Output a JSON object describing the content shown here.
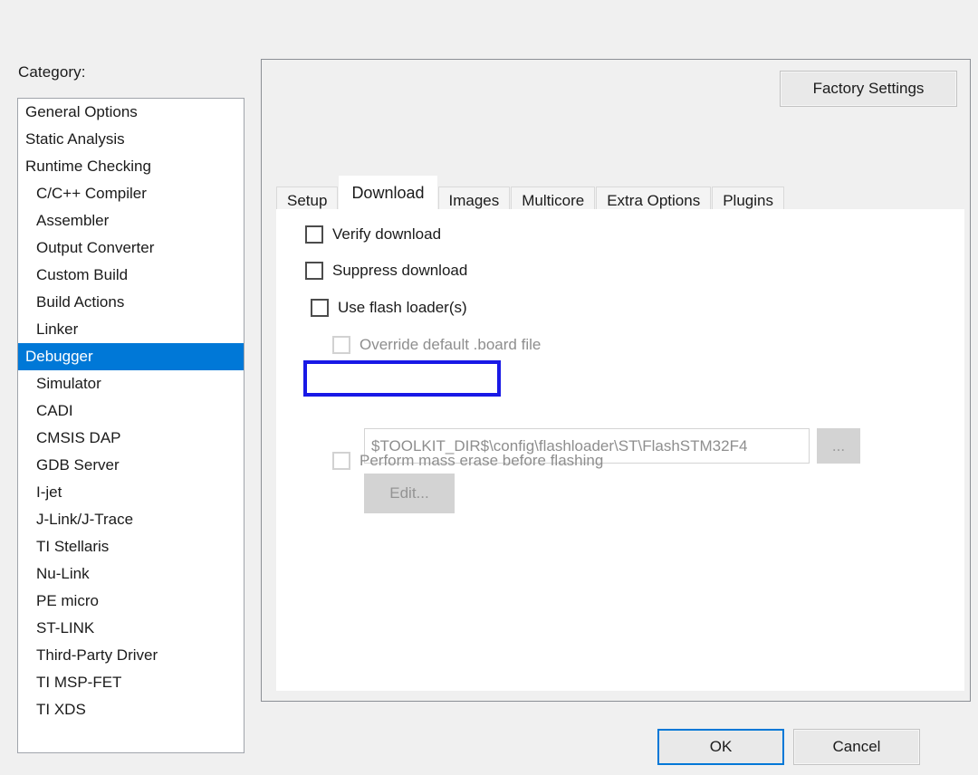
{
  "category": {
    "label": "Category:",
    "items": [
      {
        "label": "General Options",
        "indent": false,
        "selected": false
      },
      {
        "label": "Static Analysis",
        "indent": false,
        "selected": false
      },
      {
        "label": "Runtime Checking",
        "indent": false,
        "selected": false
      },
      {
        "label": "C/C++ Compiler",
        "indent": true,
        "selected": false
      },
      {
        "label": "Assembler",
        "indent": true,
        "selected": false
      },
      {
        "label": "Output Converter",
        "indent": true,
        "selected": false
      },
      {
        "label": "Custom Build",
        "indent": true,
        "selected": false
      },
      {
        "label": "Build Actions",
        "indent": true,
        "selected": false
      },
      {
        "label": "Linker",
        "indent": true,
        "selected": false
      },
      {
        "label": "Debugger",
        "indent": false,
        "selected": true
      },
      {
        "label": "Simulator",
        "indent": true,
        "selected": false
      },
      {
        "label": "CADI",
        "indent": true,
        "selected": false
      },
      {
        "label": "CMSIS DAP",
        "indent": true,
        "selected": false
      },
      {
        "label": "GDB Server",
        "indent": true,
        "selected": false
      },
      {
        "label": "I-jet",
        "indent": true,
        "selected": false
      },
      {
        "label": "J-Link/J-Trace",
        "indent": true,
        "selected": false
      },
      {
        "label": "TI Stellaris",
        "indent": true,
        "selected": false
      },
      {
        "label": "Nu-Link",
        "indent": true,
        "selected": false
      },
      {
        "label": "PE micro",
        "indent": true,
        "selected": false
      },
      {
        "label": "ST-LINK",
        "indent": true,
        "selected": false
      },
      {
        "label": "Third-Party Driver",
        "indent": true,
        "selected": false
      },
      {
        "label": "TI MSP-FET",
        "indent": true,
        "selected": false
      },
      {
        "label": "TI XDS",
        "indent": true,
        "selected": false
      }
    ]
  },
  "toolbar": {
    "factory_settings_label": "Factory Settings"
  },
  "tabs": [
    {
      "label": "Setup",
      "active": false
    },
    {
      "label": "Download",
      "active": true
    },
    {
      "label": "Images",
      "active": false
    },
    {
      "label": "Multicore",
      "active": false
    },
    {
      "label": "Extra Options",
      "active": false
    },
    {
      "label": "Plugins",
      "active": false
    }
  ],
  "download_panel": {
    "verify_download_label": "Verify download",
    "verify_download_checked": false,
    "suppress_download_label": "Suppress download",
    "suppress_download_checked": false,
    "use_flash_loader_label": "Use flash loader(s)",
    "use_flash_loader_checked": false,
    "override_board_label": "Override default .board file",
    "override_board_checked": false,
    "board_path_value": "$TOOLKIT_DIR$\\config\\flashloader\\ST\\FlashSTM32F4",
    "browse_label": "...",
    "edit_label": "Edit...",
    "mass_erase_label": "Perform mass erase before flashing",
    "mass_erase_checked": false
  },
  "footer": {
    "ok_label": "OK",
    "cancel_label": "Cancel"
  },
  "colors": {
    "selection_blue": "#0078d7",
    "highlight_blue": "#1919e6",
    "background": "#f0f0f0",
    "panel_white": "#ffffff",
    "disabled_text": "#8e8e8e"
  }
}
